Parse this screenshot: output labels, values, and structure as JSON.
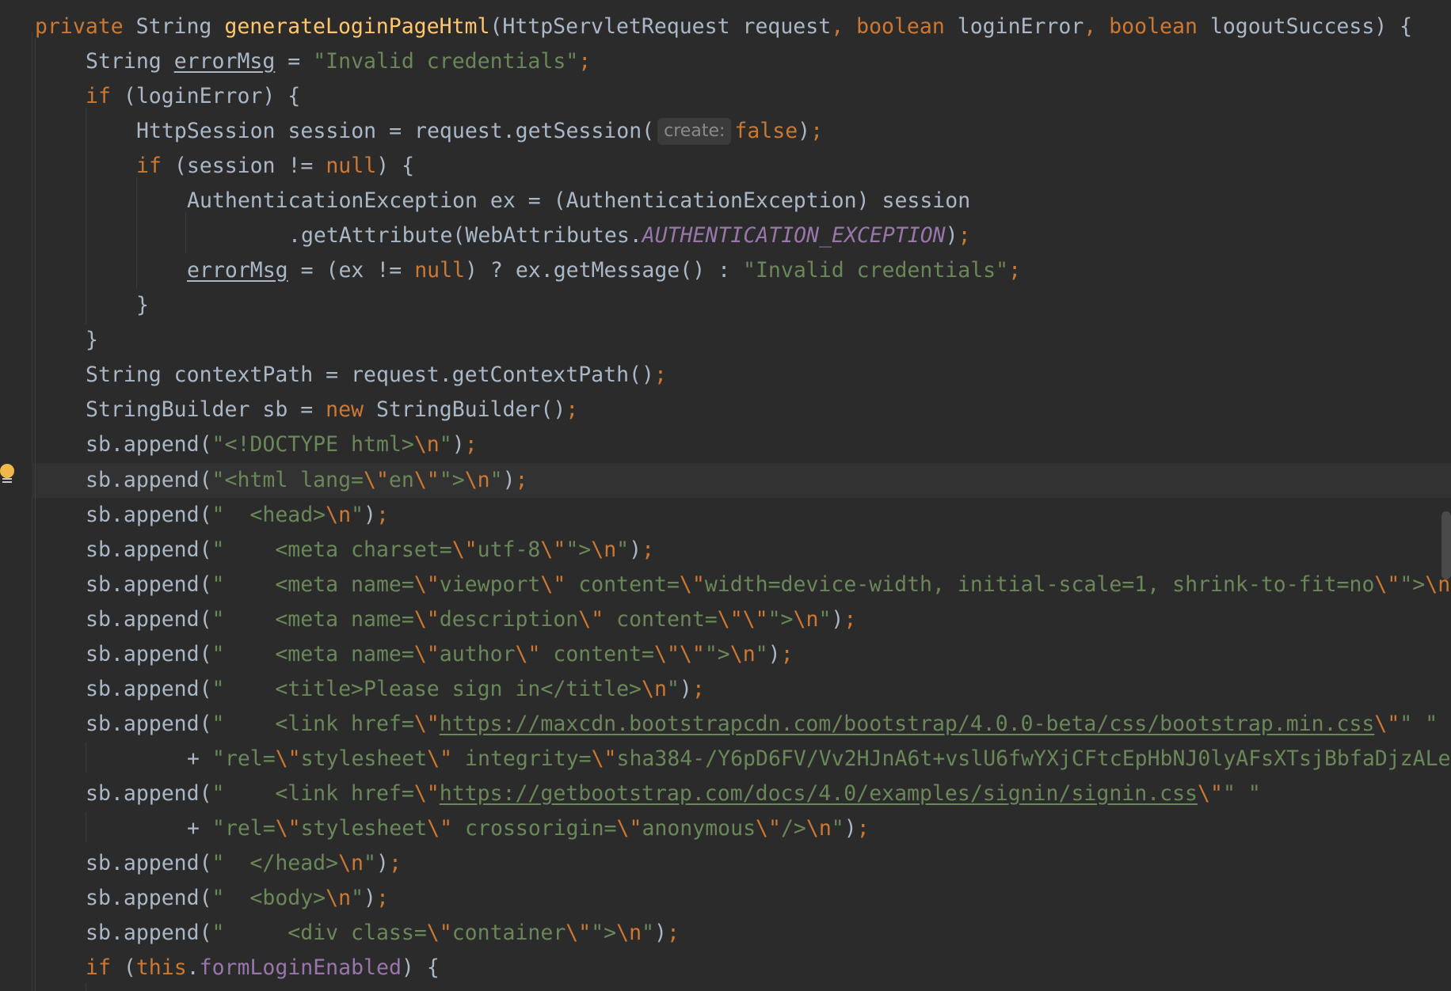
{
  "editor": {
    "signature": {
      "mod": "private",
      "ret": "String",
      "name": "generateLoginPageHtml",
      "open": "(HttpServletRequest request",
      "comma1": ", ",
      "kw1": "boolean",
      "p1": " loginError",
      "comma2": ", ",
      "kw2": "boolean",
      "p2": " logoutSuccess) {"
    },
    "l2": {
      "a": "String ",
      "var": "errorMsg",
      "b": " = ",
      "str": "\"Invalid credentials\"",
      "semi": ";"
    },
    "l3": {
      "kw": "if",
      "rest": " (loginError) {"
    },
    "l4": {
      "a": "HttpSession session = request.getSession(",
      "hint": "create:",
      "kw": "false",
      "b": ")",
      "semi": ";"
    },
    "l5": {
      "kw": "if",
      "a": " (session != ",
      "null": "null",
      "b": ") {"
    },
    "l6": {
      "text": "AuthenticationException ex = (AuthenticationException) session"
    },
    "l7": {
      "a": ".getAttribute(WebAttributes.",
      "const": "AUTHENTICATION_EXCEPTION",
      "b": ")",
      "semi": ";"
    },
    "l8": {
      "var": "errorMsg",
      "a": " = (ex != ",
      "null": "null",
      "b": ") ? ex.getMessage() : ",
      "str": "\"Invalid credentials\"",
      "semi": ";"
    },
    "l9": {
      "text": "}"
    },
    "l10": {
      "text": "}"
    },
    "l11": {
      "a": "String contextPath = request.getContextPath()",
      "semi": ";"
    },
    "l12": {
      "a": "StringBuilder sb = ",
      "kw": "new",
      "b": " StringBuilder()",
      "semi": ";"
    },
    "l13": {
      "a": "sb.append(",
      "s1": "\"<!DOCTYPE html>",
      "e1": "\\n",
      "s2": "\"",
      "b": ")",
      "semi": ";"
    },
    "l14": {
      "a": "sb.append(",
      "s1": "\"<html lang=",
      "e1": "\\\"",
      "s2": "en",
      "e2": "\\\"",
      "s3": "\">",
      "e3": "\\n",
      "s4": "\"",
      "b": ")",
      "semi": ";"
    },
    "l15": {
      "a": "sb.append(",
      "s1": "\"  <head>",
      "e1": "\\n",
      "s2": "\"",
      "b": ")",
      "semi": ";"
    },
    "l16": {
      "a": "sb.append(",
      "s1": "\"    <meta charset=",
      "e1": "\\\"",
      "s2": "utf-8",
      "e2": "\\\"",
      "s3": "\">",
      "e3": "\\n",
      "s4": "\"",
      "b": ")",
      "semi": ";"
    },
    "l17": {
      "a": "sb.append(",
      "s1": "\"    <meta name=",
      "e1": "\\\"",
      "s2": "viewport",
      "e2": "\\\"",
      "s3": " content=",
      "e3": "\\\"",
      "s4": "width=device-width, initial-scale=1, shrink-to-fit=no",
      "e4": "\\\"",
      "s5": "\">",
      "e5": "\\n",
      "s6": "\""
    },
    "l18": {
      "a": "sb.append(",
      "s1": "\"    <meta name=",
      "e1": "\\\"",
      "s2": "description",
      "e2": "\\\"",
      "s3": " content=",
      "e3": "\\\"\\\"",
      "s4": "\">",
      "e4": "\\n",
      "s5": "\"",
      "b": ")",
      "semi": ";"
    },
    "l19": {
      "a": "sb.append(",
      "s1": "\"    <meta name=",
      "e1": "\\\"",
      "s2": "author",
      "e2": "\\\"",
      "s3": " content=",
      "e3": "\\\"\\\"",
      "s4": "\">",
      "e4": "\\n",
      "s5": "\"",
      "b": ")",
      "semi": ";"
    },
    "l20": {
      "a": "sb.append(",
      "s1": "\"    <title>Please sign in</title>",
      "e1": "\\n",
      "s2": "\"",
      "b": ")",
      "semi": ";"
    },
    "l21": {
      "a": "sb.append(",
      "s1": "\"    <link href=",
      "e1": "\\\"",
      "url": "https://maxcdn.bootstrapcdn.com/bootstrap/4.0.0-beta/css/bootstrap.min.css",
      "e2": "\\\"",
      "s2": "\" \""
    },
    "l22": {
      "plus": "+ ",
      "s1": "\"rel=",
      "e1": "\\\"",
      "s2": "stylesheet",
      "e2": "\\\"",
      "s3": " integrity=",
      "e3": "\\\"",
      "s4": "sha384-/Y6pD6FV/Vv2HJnA6t+vslU6fwYXjCFtcEpHbNJ0lyAFsXTsjBbfaDjzALe"
    },
    "l23": {
      "a": "sb.append(",
      "s1": "\"    <link href=",
      "e1": "\\\"",
      "url": "https://getbootstrap.com/docs/4.0/examples/signin/signin.css",
      "e2": "\\\"",
      "s2": "\" \""
    },
    "l24": {
      "plus": "+ ",
      "s1": "\"rel=",
      "e1": "\\\"",
      "s2": "stylesheet",
      "e2": "\\\"",
      "s3": " crossorigin=",
      "e3": "\\\"",
      "s4": "anonymous",
      "e4": "\\\"",
      "s5": "/>",
      "e5": "\\n",
      "s6": "\"",
      "b": ")",
      "semi": ";"
    },
    "l25": {
      "a": "sb.append(",
      "s1": "\"  </head>",
      "e1": "\\n",
      "s2": "\"",
      "b": ")",
      "semi": ";"
    },
    "l26": {
      "a": "sb.append(",
      "s1": "\"  <body>",
      "e1": "\\n",
      "s2": "\"",
      "b": ")",
      "semi": ";"
    },
    "l27": {
      "a": "sb.append(",
      "s1": "\"     <div class=",
      "e1": "\\\"",
      "s2": "container",
      "e2": "\\\"",
      "s3": "\">",
      "e3": "\\n",
      "s4": "\"",
      "b": ")",
      "semi": ";"
    },
    "l28": {
      "kw": "if",
      "a": " (",
      "this": "this",
      "dot": ".",
      "field": "formLoginEnabled",
      "b": ") {"
    }
  },
  "colors": {
    "background": "#2b2b2b",
    "keyword": "#cc7832",
    "string": "#6a8759",
    "function": "#ffc66d",
    "field": "#9876aa",
    "text": "#a9b7c6"
  }
}
